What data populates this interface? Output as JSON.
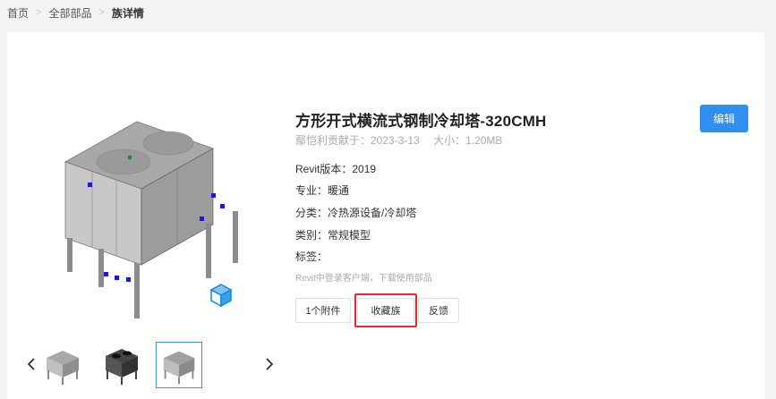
{
  "breadcrumb": {
    "home": "首页",
    "all_parts": "全部部品",
    "current": "族详情",
    "separator": ">"
  },
  "product": {
    "title": "方形开式横流式钢制冷却塔-320CMH",
    "contributor": "鄢恺利贡献于：2023-3-13",
    "size": "大小：1.20MB",
    "revit_version": "Revit版本：2019",
    "discipline": "专业：暖通",
    "category": "分类：冷热源设备/冷却塔",
    "type": "类别：常规模型",
    "tags": "标签：",
    "hint": "Revit中登录客户端，下载使用部品"
  },
  "buttons": {
    "attachments": "1个附件",
    "favorite": "收藏族",
    "feedback": "反馈",
    "edit": "编辑"
  },
  "gallery": {
    "prev_icon": "chevron-left-icon",
    "next_icon": "chevron-right-icon",
    "selected_index": 3,
    "view3d_icon": "cube-icon"
  },
  "colors": {
    "accent": "#2f8ff0",
    "highlight": "#e5282c",
    "thumb_border": "#3f8fe6"
  }
}
